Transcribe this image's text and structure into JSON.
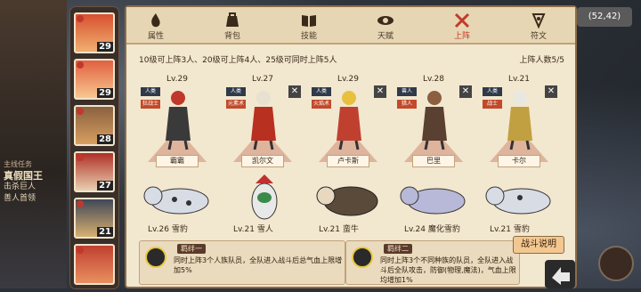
{
  "coords": "(52,42)",
  "quest": {
    "title": "主线任务",
    "main": "真假国王",
    "line1": "击杀巨人",
    "line2": "善人首领"
  },
  "heroes": [
    {
      "lv": "29"
    },
    {
      "lv": "29"
    },
    {
      "lv": "28"
    },
    {
      "lv": "27"
    },
    {
      "lv": "21"
    },
    {
      "lv": ""
    }
  ],
  "tabs": [
    {
      "label": "属性"
    },
    {
      "label": "背包"
    },
    {
      "label": "技能"
    },
    {
      "label": "天赋"
    },
    {
      "label": "上阵"
    },
    {
      "label": "符文"
    }
  ],
  "info": {
    "rule": "10级可上阵3人、20级可上阵4人、25级可同时上阵5人",
    "count": "上阵人数5/5"
  },
  "cards": [
    {
      "lv": "Lv.29",
      "tag1": "人类",
      "tag2": "狂战士",
      "name": "霸霸",
      "closable": false,
      "colors": [
        "#c0382c",
        "#3a3a3a"
      ]
    },
    {
      "lv": "Lv.27",
      "tag1": "人类",
      "tag2": "元素术",
      "name": "凯尔文",
      "closable": true,
      "colors": [
        "#e8e0d0",
        "#b83020"
      ]
    },
    {
      "lv": "Lv.29",
      "tag1": "人类",
      "tag2": "火焰术",
      "name": "卢卡斯",
      "closable": true,
      "colors": [
        "#e8c040",
        "#c04030"
      ]
    },
    {
      "lv": "Lv.28",
      "tag1": "兽人",
      "tag2": "猎人",
      "name": "巴里",
      "closable": true,
      "colors": [
        "#8a6040",
        "#5a4030"
      ]
    },
    {
      "lv": "Lv.21",
      "tag1": "人类",
      "tag2": "战士",
      "name": "卡尔",
      "closable": true,
      "colors": [
        "#e8e8e0",
        "#c0a040"
      ]
    }
  ],
  "pets": [
    {
      "label": "Lv.26 雪豹"
    },
    {
      "label": "Lv.21 雪人"
    },
    {
      "label": "Lv.21 蛮牛"
    },
    {
      "label": "Lv.24 魔化雪豹"
    },
    {
      "label": "Lv.21 雪豹"
    }
  ],
  "bonds": [
    {
      "title": "羁绊一",
      "text": "同时上阵3个人族队员，全队进入战斗后总气血上限增加5%"
    },
    {
      "title": "羁绊二",
      "text": "同时上阵3个不同种族的队员，全队进入战斗后全队攻击，防御(物理,魔法)，气血上限均增加1%"
    }
  ],
  "fight_button": "战斗说明"
}
